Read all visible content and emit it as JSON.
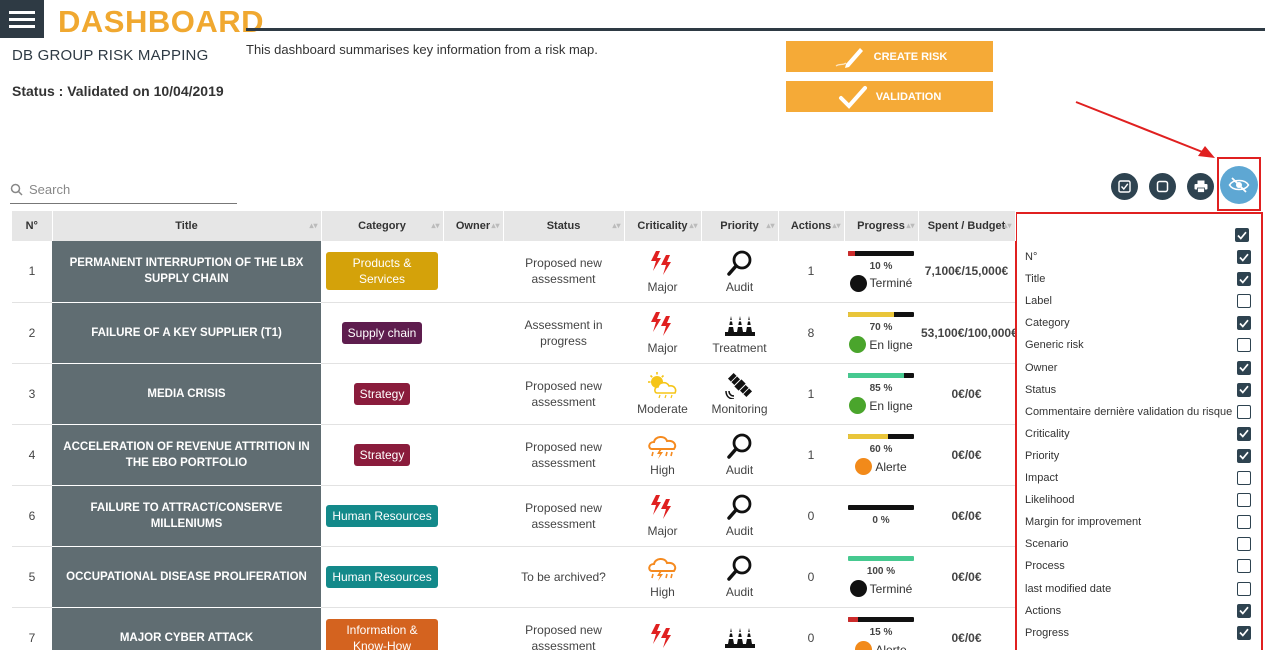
{
  "header": {
    "title": "DASHBOARD",
    "subtitle": "DB GROUP RISK MAPPING",
    "status": "Status : Validated on 10/04/2019",
    "description": "This dashboard summarises key information from a risk map.",
    "create_label": "CREATE RISK",
    "validate_label": "VALIDATION"
  },
  "search": {
    "placeholder": "Search"
  },
  "table": {
    "columns": [
      "N°",
      "Title",
      "Category",
      "Owner",
      "Status",
      "Criticality",
      "Priority",
      "Actions",
      "Progress",
      "Spent / Budget"
    ],
    "rows": [
      {
        "n": "1",
        "title": "PERMANENT INTERRUPTION OF THE LBX SUPPLY CHAIN",
        "category": "Products & Services",
        "category_color": "#d4a20a",
        "owner": "",
        "status": "Proposed new assessment",
        "criticality": "Major",
        "criticality_icon": "lightning-icon",
        "priority": "Audit",
        "priority_icon": "magnifier-icon",
        "actions": "1",
        "progress": 10,
        "progress_color": "#cc2b2b",
        "progress_label": "10 %",
        "state": "Terminé",
        "state_color": "#111111",
        "budget": "7,100€/15,000€"
      },
      {
        "n": "2",
        "title": "FAILURE OF A KEY SUPPLIER (T1)",
        "category": "Supply chain",
        "category_color": "#5e1d4e",
        "owner": "",
        "status": "Assessment in progress",
        "criticality": "Major",
        "criticality_icon": "lightning-icon",
        "priority": "Treatment",
        "priority_icon": "cones-icon",
        "actions": "8",
        "progress": 70,
        "progress_color": "#e9c53a",
        "progress_label": "70 %",
        "state": "En ligne",
        "state_color": "#4aa52c",
        "budget": "53,100€/100,000€"
      },
      {
        "n": "3",
        "title": "MEDIA CRISIS",
        "category": "Strategy",
        "category_color": "#8a1c3c",
        "owner": "",
        "status": "Proposed new assessment",
        "criticality": "Moderate",
        "criticality_icon": "sun-cloud-icon",
        "priority": "Monitoring",
        "priority_icon": "satellite-icon",
        "actions": "1",
        "progress": 85,
        "progress_color": "#46c990",
        "progress_label": "85 %",
        "state": "En ligne",
        "state_color": "#4aa52c",
        "budget": "0€/0€"
      },
      {
        "n": "4",
        "title": "ACCELERATION OF REVENUE ATTRITION IN THE EBO PORTFOLIO",
        "category": "Strategy",
        "category_color": "#8a1c3c",
        "owner": "",
        "status": "Proposed new assessment",
        "criticality": "High",
        "criticality_icon": "storm-cloud-icon",
        "priority": "Audit",
        "priority_icon": "magnifier-icon",
        "actions": "1",
        "progress": 60,
        "progress_color": "#e9c53a",
        "progress_label": "60 %",
        "state": "Alerte",
        "state_color": "#f28a1a",
        "budget": "0€/0€"
      },
      {
        "n": "6",
        "title": "FAILURE TO ATTRACT/CONSERVE MILLENIUMS",
        "category": "Human Resources",
        "category_color": "#13898a",
        "owner": "",
        "status": "Proposed new assessment",
        "criticality": "Major",
        "criticality_icon": "lightning-icon",
        "priority": "Audit",
        "priority_icon": "magnifier-icon",
        "actions": "0",
        "progress": 0,
        "progress_color": "#111111",
        "progress_label": "0 %",
        "state": "",
        "state_color": "",
        "budget": "0€/0€"
      },
      {
        "n": "5",
        "title": "OCCUPATIONAL DISEASE PROLIFERATION",
        "category": "Human Resources",
        "category_color": "#13898a",
        "owner": "",
        "status": "To be archived?",
        "criticality": "High",
        "criticality_icon": "storm-cloud-icon",
        "priority": "Audit",
        "priority_icon": "magnifier-icon",
        "actions": "0",
        "progress": 100,
        "progress_color": "#46c990",
        "progress_label": "100 %",
        "state": "Terminé",
        "state_color": "#111111",
        "budget": "0€/0€"
      },
      {
        "n": "7",
        "title": "MAJOR CYBER ATTACK",
        "category": "Information & Know-How",
        "category_color": "#d4631f",
        "owner": "",
        "status": "Proposed new assessment",
        "criticality": "",
        "criticality_icon": "lightning-icon",
        "priority": "",
        "priority_icon": "cones-icon",
        "actions": "0",
        "progress": 15,
        "progress_color": "#cc2b2b",
        "progress_label": "15 %",
        "state": "Alerte",
        "state_color": "#f28a1a",
        "budget": "0€/0€"
      }
    ]
  },
  "column_panel": {
    "items": [
      {
        "label": "N°",
        "checked": true
      },
      {
        "label": "Title",
        "checked": true
      },
      {
        "label": "Label",
        "checked": false
      },
      {
        "label": "Category",
        "checked": true
      },
      {
        "label": "Generic risk",
        "checked": false
      },
      {
        "label": "Owner",
        "checked": true
      },
      {
        "label": "Status",
        "checked": true
      },
      {
        "label": "Commentaire dernière validation du risque",
        "checked": false
      },
      {
        "label": "Criticality",
        "checked": true
      },
      {
        "label": "Priority",
        "checked": true
      },
      {
        "label": "Impact",
        "checked": false
      },
      {
        "label": "Likelihood",
        "checked": false
      },
      {
        "label": "Margin for improvement",
        "checked": false
      },
      {
        "label": "Scenario",
        "checked": false
      },
      {
        "label": "Process",
        "checked": false
      },
      {
        "label": "last modified date",
        "checked": false
      },
      {
        "label": "Actions",
        "checked": true
      },
      {
        "label": "Progress",
        "checked": true
      }
    ]
  },
  "colors": {
    "accent": "#f5aa37",
    "dark": "#2e3a44",
    "highlight": "#e02020",
    "eye_button": "#5ea7d3"
  }
}
